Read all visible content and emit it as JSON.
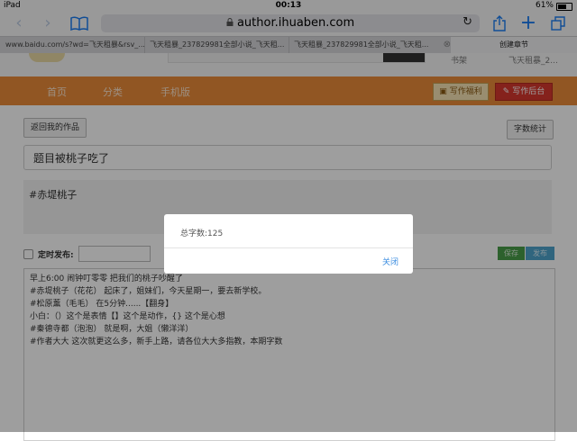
{
  "status_bar": {
    "device": "iPad",
    "time": "00:13",
    "battery": "61%"
  },
  "browser": {
    "url": "author.ihuaben.com",
    "tabs": [
      {
        "title": "www.baidu.com/s?wd=飞天租暴&rsv_..."
      },
      {
        "title": "飞天租暴_237829981全部小说_飞天租..."
      },
      {
        "title": "飞天租暴_237829981全部小说_飞天租..."
      },
      {
        "title": "创建章节"
      }
    ]
  },
  "site_header": {
    "bookshelf": "书架",
    "user": "飞天租暴_2..."
  },
  "nav": {
    "items": [
      "首页",
      "分类",
      "手机版"
    ],
    "welfare_label": "写作福利",
    "backend_label": "写作后台"
  },
  "editor_page": {
    "back_button": "返回我的作品",
    "word_count_button": "字数统计",
    "title_value": "题目被桃子吃了",
    "tag_text": "#赤堤桃子",
    "schedule_label": "定时发布:",
    "save_button": "保存",
    "publish_button": "发布",
    "content_lines": [
      "早上6:00 闹钟叮零零 把我们的桃子吵醒了",
      "#赤堤桃子（花花） 起床了，姐妹们，今天星期一，要去新学校。",
      "#松原薰（毛毛） 在5分钟......【翻身】",
      "小白：（）这个是表情【】这个是动作，{} 这个是心想",
      "#秦德寺都（泡泡） 就是啊，大姐（懒洋洋）",
      "#作者大大 这次就更这么多，新手上路，请各位大大多指教，本期字数"
    ]
  },
  "dialog": {
    "message": "总字数:125",
    "close_label": "关闭"
  },
  "colors": {
    "nav_orange": "#ea8c39",
    "backend_red": "#d7382e",
    "save_green": "#4a9d4a",
    "publish_blue": "#4ea3cc",
    "ios_blue": "#1a7cf3"
  }
}
